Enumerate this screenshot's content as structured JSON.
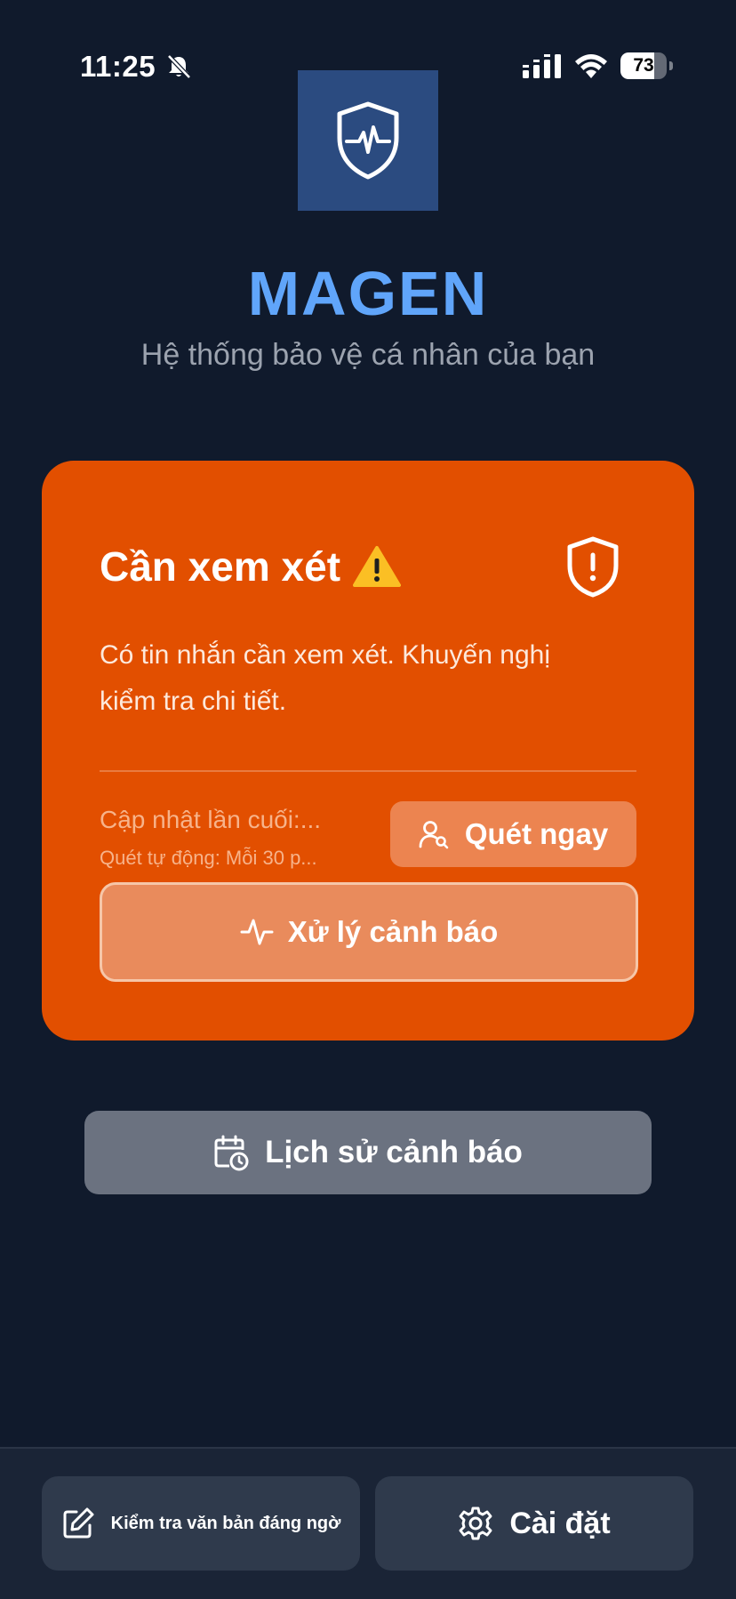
{
  "status_bar": {
    "time": "11:25",
    "battery_level": 73,
    "battery_text": "73",
    "icons": [
      "bell-muted-icon",
      "cellular-signal-icon",
      "wifi-icon",
      "battery-icon"
    ]
  },
  "header": {
    "logo_icon": "shield-heartbeat-icon",
    "title": "MAGEN",
    "subtitle": "Hệ thống bảo vệ cá nhân của bạn"
  },
  "status_card": {
    "title": "Cần xem xét",
    "title_icon": "warning-icon",
    "badge_icon": "shield-alert-icon",
    "message": "Có tin nhắn cần xem xét. Khuyến nghị kiểm tra chi tiết.",
    "last_updated": "Cập nhật lần cuối:...",
    "auto_scan": "Quét tự động: Mỗi 30 p...",
    "scan_button_label": "Quét ngay",
    "handle_button_label": "Xử lý cảnh báo",
    "color": "#e24f00"
  },
  "history_button_label": "Lịch sử cảnh báo",
  "bottom_bar": {
    "check_text_label": "Kiểm tra văn bản đáng ngờ",
    "settings_label": "Cài đặt"
  },
  "colors": {
    "background": "#101a2c",
    "accent": "#60a5fa",
    "card": "#e24f00"
  }
}
